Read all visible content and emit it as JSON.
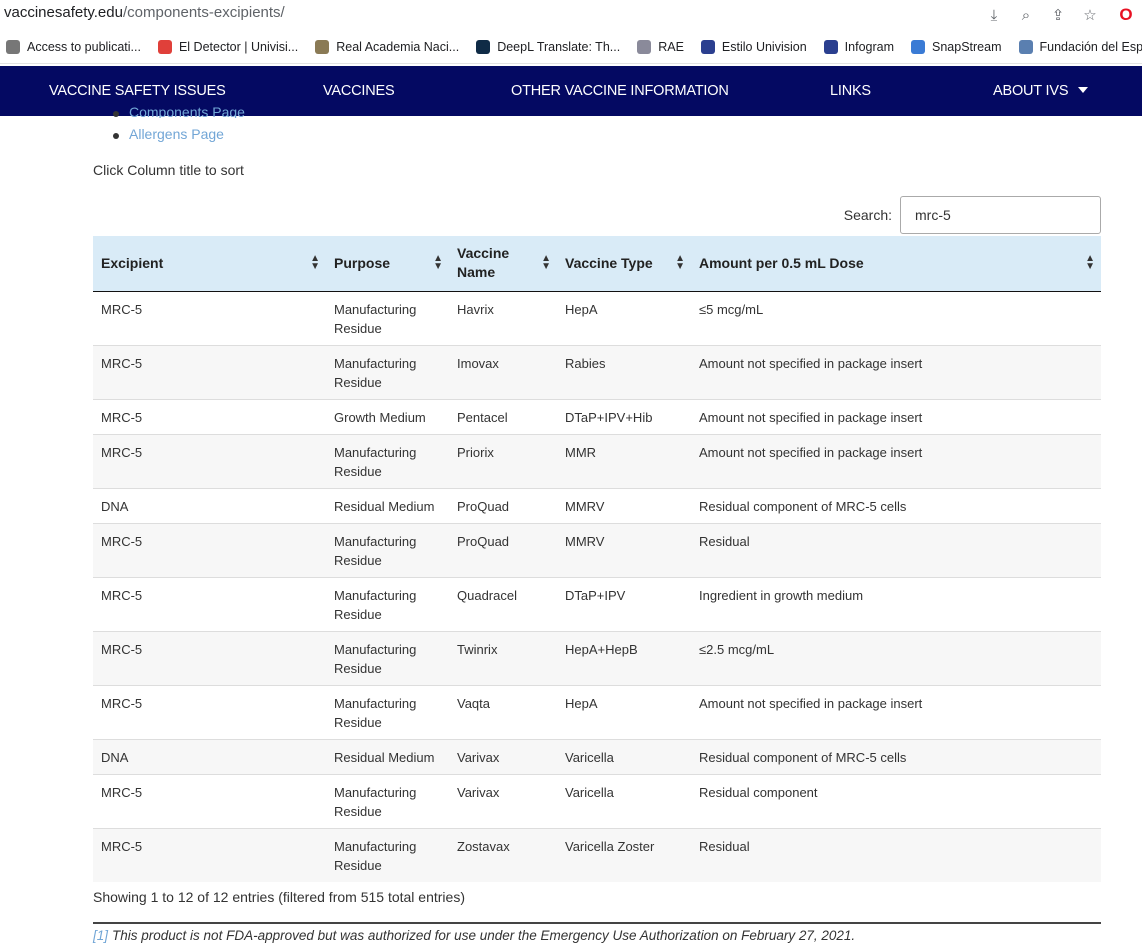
{
  "browser": {
    "url_domain": "vaccinesafety.edu",
    "url_path": "/components-excipients/",
    "bookmarks": [
      {
        "label": "Access to publicati...",
        "icon": "page-icon",
        "color": "#777777"
      },
      {
        "label": "El Detector | Univisi...",
        "icon": "univision-icon",
        "color": "#e0403a"
      },
      {
        "label": "Real Academia Naci...",
        "icon": "crest-icon",
        "color": "#8a7a55"
      },
      {
        "label": "DeepL Translate: Th...",
        "icon": "deepl-icon",
        "color": "#0f2b46"
      },
      {
        "label": "RAE",
        "icon": "rae-icon",
        "color": "#8a8a9a"
      },
      {
        "label": "Estilo Univision",
        "icon": "estilo-icon",
        "color": "#2b3f8f"
      },
      {
        "label": "Infogram",
        "icon": "infogram-icon",
        "color": "#2a3f8f"
      },
      {
        "label": "SnapStream",
        "icon": "snapstream-icon",
        "color": "#3a7bd5"
      },
      {
        "label": "Fundación del Espa...",
        "icon": "fundacion-icon",
        "color": "#5a7fb0"
      }
    ]
  },
  "nav": {
    "items": [
      "VACCINE SAFETY ISSUES",
      "VACCINES",
      "OTHER VACCINE INFORMATION",
      "LINKS",
      "ABOUT IVS"
    ]
  },
  "page": {
    "links": [
      "Components Page",
      "Allergens Page"
    ],
    "sort_hint": "Click Column title to sort",
    "search_label": "Search:",
    "search_value": "mrc-5",
    "info": "Showing 1 to 12 of 12 entries (filtered from 515 total entries)",
    "footnote_ref": "[1]",
    "footnote_text": "This product is not FDA-approved but was authorized for use under the Emergency Use Authorization on February 27, 2021."
  },
  "table": {
    "headers": [
      "Excipient",
      "Purpose",
      "Vaccine Name",
      "Vaccine Type",
      "Amount per 0.5 mL Dose"
    ],
    "rows": [
      [
        "MRC-5",
        "Manufacturing Residue",
        "Havrix",
        "HepA",
        "≤5 mcg/mL"
      ],
      [
        "MRC-5",
        "Manufacturing Residue",
        "Imovax",
        "Rabies",
        "Amount not specified in package insert"
      ],
      [
        "MRC-5",
        "Growth Medium",
        "Pentacel",
        "DTaP+IPV+Hib",
        "Amount not specified in package insert"
      ],
      [
        "MRC-5",
        "Manufacturing Residue",
        "Priorix",
        "MMR",
        "Amount not specified in package insert"
      ],
      [
        "DNA",
        "Residual Medium",
        "ProQuad",
        "MMRV",
        "Residual component of MRC-5 cells"
      ],
      [
        "MRC-5",
        "Manufacturing Residue",
        "ProQuad",
        "MMRV",
        "Residual"
      ],
      [
        "MRC-5",
        "Manufacturing Residue",
        "Quadracel",
        "DTaP+IPV",
        "Ingredient in growth medium"
      ],
      [
        "MRC-5",
        "Manufacturing Residue",
        "Twinrix",
        "HepA+HepB",
        "≤2.5 mcg/mL"
      ],
      [
        "MRC-5",
        "Manufacturing Residue",
        "Vaqta",
        "HepA",
        "Amount not specified in package insert"
      ],
      [
        "DNA",
        "Residual Medium",
        "Varivax",
        "Varicella",
        "Residual component of MRC-5 cells"
      ],
      [
        "MRC-5",
        "Manufacturing Residue",
        "Varivax",
        "Varicella",
        "Residual component"
      ],
      [
        "MRC-5",
        "Manufacturing Residue",
        "Zostavax",
        "Varicella Zoster",
        "Residual"
      ]
    ]
  }
}
